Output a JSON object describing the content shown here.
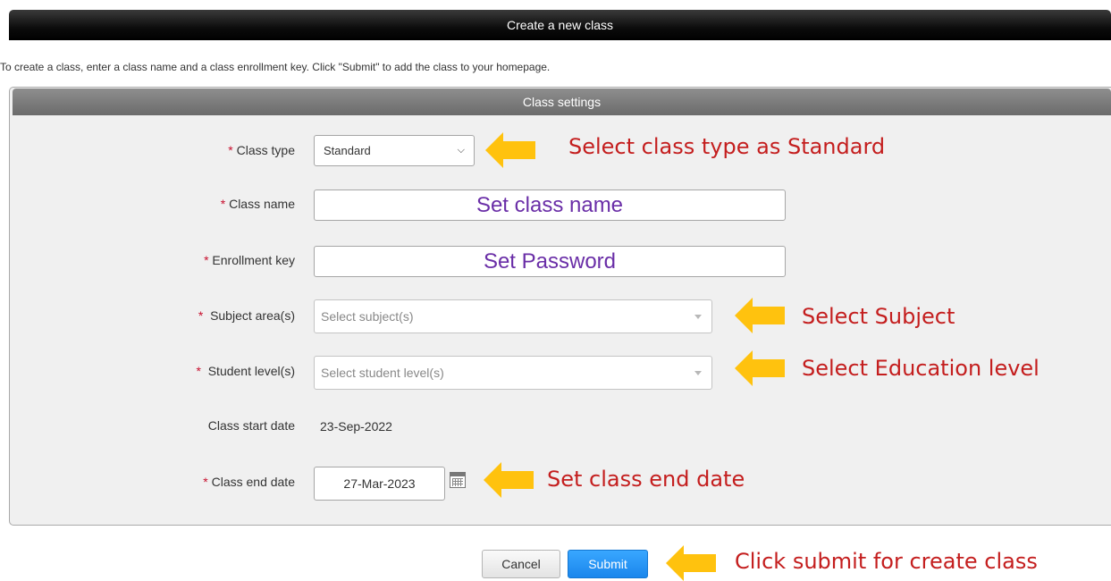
{
  "header": {
    "title": "Create a new class"
  },
  "intro": "To create a class, enter a class name and a class enrollment key. Click \"Submit\" to add the class to your homepage.",
  "panel": {
    "title": "Class settings"
  },
  "form": {
    "required_mark": "*",
    "class_type": {
      "label": "Class type",
      "value": "Standard"
    },
    "class_name": {
      "label": "Class name",
      "value": "Set class name"
    },
    "enrollment_key": {
      "label": "Enrollment key",
      "value": "Set Password"
    },
    "subject_area": {
      "label": "Subject area(s)",
      "placeholder": "Select subject(s)"
    },
    "student_level": {
      "label": "Student level(s)",
      "placeholder": "Select student level(s)"
    },
    "start_date": {
      "label": "Class start date",
      "value": "23-Sep-2022"
    },
    "end_date": {
      "label": "Class end date",
      "value": "27-Mar-2023"
    }
  },
  "buttons": {
    "cancel": "Cancel",
    "submit": "Submit"
  },
  "annotations": {
    "class_type": "Select class type as Standard",
    "subject": "Select Subject",
    "level": "Select Education level",
    "end_date": "Set class end date",
    "submit": "Click submit for create class"
  },
  "colors": {
    "arrow": "#ffc20e",
    "note_text": "#c41e1e",
    "input_text": "#6a2ea7",
    "submit_button": "#1a86ec"
  },
  "icons": {
    "dropdown": "chevron-down-icon",
    "calendar": "calendar-icon",
    "pointer": "arrow-left-icon"
  }
}
